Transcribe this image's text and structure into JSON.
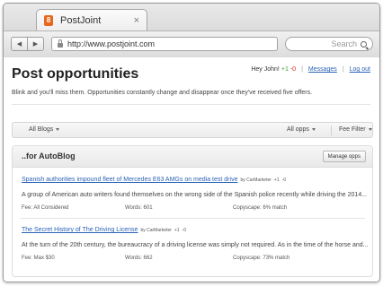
{
  "browser": {
    "tab_title": "PostJoint",
    "tab_close": "×",
    "url": "http://www.postjoint.com",
    "search_placeholder": "Search",
    "favicon_letter": "8",
    "back_glyph": "◀",
    "forward_glyph": "▶",
    "icons": [
      "lock-icon",
      "search-icon",
      "close-icon",
      "back-arrow-icon",
      "forward-arrow-icon"
    ]
  },
  "header": {
    "title": "Post opportunities",
    "greeting": "Hey John!",
    "karma_pos": "+1",
    "karma_neg": "-0",
    "messages_label": "Messages",
    "separator": "|",
    "logout_label": "Log out"
  },
  "intro": "Blink and you'll miss them. Opportunities constantly change and disappear once they've received five offers.",
  "filters": {
    "all_blogs": "All Blogs",
    "all_opps": "All opps",
    "fee_filter": "Fee Filter"
  },
  "panel": {
    "title": "..for AutoBlog",
    "manage_label": "Manage opps"
  },
  "opportunities": [
    {
      "title": "Spanish authorities impound fleet of Mercedes E63 AMGs on media test drive",
      "by": "by CarMarketer",
      "pos": "+1",
      "neg": "-0",
      "excerpt": "A group of American auto writers found themselves on the wrong side of the Spanish police recently while driving the 2014...",
      "fee": "Fee:  All Considered",
      "words": "Words:  601",
      "copyscape": "Copyscape:  6% match"
    },
    {
      "title": "The Secret History of The Driving License",
      "by": "by CarMarketer",
      "pos": "+1",
      "neg": "-0",
      "excerpt": "At the turn of the 20th century, the bureaucracy of a driving license was simply not required. As in the time of the horse and...",
      "fee": "Fee:  Max $30",
      "words": "Words:  662",
      "copyscape": "Copyscape:  73% match"
    }
  ],
  "colors": {
    "link": "#2a63b5",
    "positive": "#3a9b2a",
    "negative": "#cc2a1f",
    "favicon": "#e8671e"
  }
}
